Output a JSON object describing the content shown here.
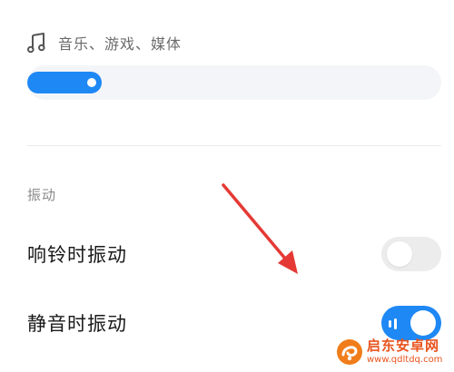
{
  "media": {
    "icon": "music-note-icon",
    "label": "音乐、游戏、媒体",
    "volume_fraction": 0.18
  },
  "vibration": {
    "section_title": "振动",
    "items": [
      {
        "label": "响铃时振动",
        "enabled": false
      },
      {
        "label": "静音时振动",
        "enabled": true
      }
    ]
  },
  "annotation": {
    "arrow_color": "#e53935"
  },
  "watermark": {
    "title": "启东安卓网",
    "url": "www.qdltdq.com",
    "logo_icon": "orange-swirl-logo"
  },
  "colors": {
    "accent": "#1e88f5",
    "track": "#f4f5f8",
    "toggle_off": "#ececec"
  }
}
